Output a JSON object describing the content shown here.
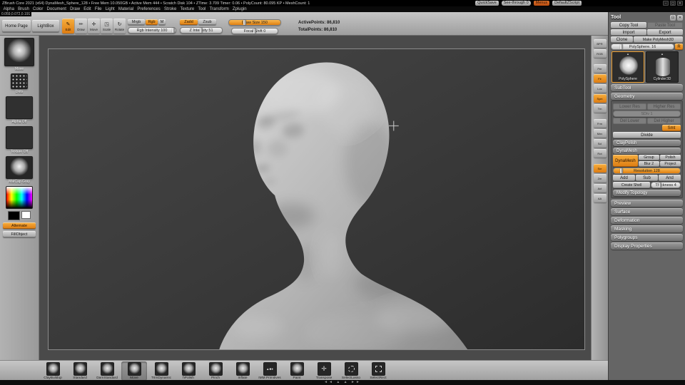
{
  "titlebar": {
    "title": "ZBrush Core 2021 (x64)  DynaMesh_Sphere_128 • Free Mem 10.050GB • Active Mem 444 • Scratch Disk 104 • ZTime: 3.709  Timer: 0.06 • PolyCount: 80.095 KP • MeshCount: 1",
    "quicksave": "QuickSave",
    "see_through": "See-through 0",
    "menus": "Menus",
    "zscript": "DefaultZScript",
    "window_icons": [
      {
        "name": "minimize-icon",
        "glyph": "–"
      },
      {
        "name": "maximize-icon",
        "glyph": "▢"
      },
      {
        "name": "close-icon",
        "glyph": "✕"
      }
    ]
  },
  "menubar": {
    "items": [
      "Alpha",
      "Brush",
      "Color",
      "Document",
      "Draw",
      "Edit",
      "File",
      "Light",
      "Material",
      "Preferences",
      "Stroke",
      "Texture",
      "Tool",
      "Transform",
      "Zplugin"
    ]
  },
  "coords": "0.059,0.072,0.191",
  "topshelf": {
    "home_page": "Home Page",
    "lightbox": "LightBox",
    "modes": [
      {
        "name": "edit-mode-button",
        "label": "Edit",
        "glyph": "✎",
        "active": true
      },
      {
        "name": "draw-mode-button",
        "label": "Draw",
        "glyph": "✏"
      },
      {
        "name": "move-mode-button",
        "label": "Move",
        "glyph": "✛"
      },
      {
        "name": "scale-mode-button",
        "label": "Scale",
        "glyph": "◳"
      },
      {
        "name": "rotate-mode-button",
        "label": "Rotate",
        "glyph": "↻"
      }
    ],
    "mrgb": "Mrgb",
    "rgb": "Rgb",
    "m": "M",
    "rgb_intensity": "Rgb Intensity 100",
    "zadd": "Zadd",
    "zsub": "Zsub",
    "z_intensity": "Z Intensity 51",
    "draw_size": "Draw Size 150",
    "focal_shift": "Focal Shift 0",
    "active_points": "ActivePoints: 86,810",
    "total_points": "TotalPoints: 86,810"
  },
  "lefttray": {
    "brush_label": "Move",
    "stroke_label": "Dots",
    "alpha_label": "Alpha Off",
    "texture_label": "Texture Off",
    "material_label": "MatCap Gray",
    "alternate": "Alternate",
    "fillobject": "FillObject"
  },
  "rightstrip": {
    "icons": [
      {
        "name": "bpr-render-icon",
        "short": "BPR"
      },
      {
        "name": "render-rgb-icon",
        "short": "RGB"
      },
      {
        "name": "perspective-icon",
        "short": "Per",
        "gap": true
      },
      {
        "name": "floor-grid-icon",
        "short": "Flr",
        "active": true
      },
      {
        "name": "local-transform-icon",
        "short": "Loc"
      },
      {
        "name": "symmetry-icon",
        "short": "Sym",
        "active": true
      },
      {
        "name": "transparency-icon",
        "short": "Trn"
      },
      {
        "name": "frame-icon",
        "short": "Frm",
        "gap": true
      },
      {
        "name": "move-canvas-icon",
        "short": "Mov"
      },
      {
        "name": "scale-canvas-icon",
        "short": "Scl"
      },
      {
        "name": "rotate-canvas-icon",
        "short": "Rot"
      },
      {
        "name": "scroll-icon",
        "short": "Scr",
        "gap": true,
        "active": true
      },
      {
        "name": "zoom-icon",
        "short": "Zm"
      },
      {
        "name": "actual-size-icon",
        "short": "Act"
      },
      {
        "name": "aa-half-icon",
        "short": "AA"
      }
    ]
  },
  "tool_panel": {
    "title": "Tool",
    "header_icons": [
      {
        "name": "palette-dock-icon",
        "glyph": "⊡"
      },
      {
        "name": "palette-close-icon",
        "glyph": "✕"
      }
    ],
    "copy": "Copy Tool",
    "paste": "Paste Tool",
    "import": "Import",
    "export": "Export",
    "clone": "Clone",
    "make_polymesh": "Make PolyMesh3D",
    "item_slider": "PolySphere. 16",
    "r": "R",
    "flyout_arrow": "▲",
    "tools": [
      {
        "name": "tool-slot-polysphere",
        "label": "PolySphere",
        "kind": "sphere",
        "active": true
      },
      {
        "name": "tool-slot-cylinder3d",
        "label": "Cylinder3D",
        "kind": "cylinder"
      }
    ],
    "subtool": "SubTool",
    "geometry": "Geometry",
    "lower_res": "Lower Res",
    "higher_res": "Higher Res",
    "sdiv": "SDiv 1",
    "del_lower": "Del Lower",
    "del_higher": "Del Higher",
    "smt": "Smt",
    "divide": "Divide",
    "claypolish": "ClayPolish",
    "dynamesh_header": "DynaMesh",
    "dynamesh": "DynaMesh",
    "group": "Group",
    "polish": "Polish",
    "blur": "Blur 2",
    "project": "Project",
    "resolution": "Resolution 128",
    "add": "Add",
    "sub": "Sub",
    "and": "And",
    "create_shell": "Create Shell",
    "thickness": "Thickness 4",
    "modify_topology": "Modify Topology",
    "sections": [
      "Preview",
      "Surface",
      "Deformation",
      "Masking",
      "Polygroups",
      "Display Properties"
    ]
  },
  "bottomshelf": {
    "brushes": [
      {
        "name": "brush-claybuildup",
        "label": "ClayBuildup",
        "kind": "sphere"
      },
      {
        "name": "brush-standard",
        "label": "Standard",
        "kind": "sphere"
      },
      {
        "name": "brush-damstandard",
        "label": "DamStandard",
        "kind": "sphere"
      },
      {
        "name": "brush-move",
        "label": "Move",
        "kind": "sphere",
        "selected": true
      },
      {
        "name": "brush-trimdynamic",
        "label": "TrimDynamic",
        "kind": "sphere"
      },
      {
        "name": "brush-hpolish",
        "label": "hPolish",
        "kind": "sphere"
      },
      {
        "name": "brush-pinch",
        "label": "Pinch",
        "kind": "sphere"
      },
      {
        "name": "brush-inflate",
        "label": "Inflate",
        "kind": "sphere"
      },
      {
        "name": "brush-imm-primitives",
        "label": "IMM Primitives",
        "kind": "imm"
      },
      {
        "name": "brush-paint",
        "label": "Paint",
        "kind": "sphere"
      },
      {
        "name": "brush-transpose",
        "label": "Transpose",
        "kind": "gizmo"
      },
      {
        "name": "brush-selectlasso",
        "label": "SelectLasso",
        "kind": "lasso"
      },
      {
        "name": "brush-selectrect",
        "label": "SelectRect",
        "kind": "rect"
      }
    ]
  },
  "scrubber": "◄◄ ▲ ▲ ►►"
}
